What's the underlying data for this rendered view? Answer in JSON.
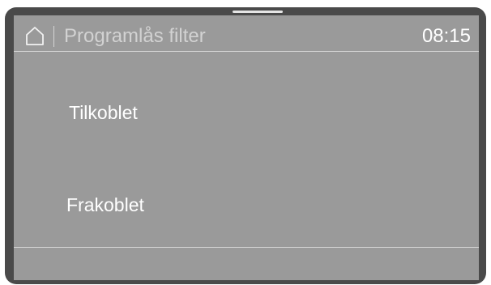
{
  "header": {
    "home_icon": "home-icon",
    "title": "Programlås filter",
    "time": "08:15"
  },
  "options": [
    {
      "label": "Tilkoblet"
    },
    {
      "label": "Frakoblet"
    }
  ],
  "colors": {
    "bezel": "#4a4a4a",
    "screen": "#9a9a9a",
    "text": "#ffffff",
    "title_text": "#d2d2d2",
    "divider": "#d3d3d3"
  }
}
